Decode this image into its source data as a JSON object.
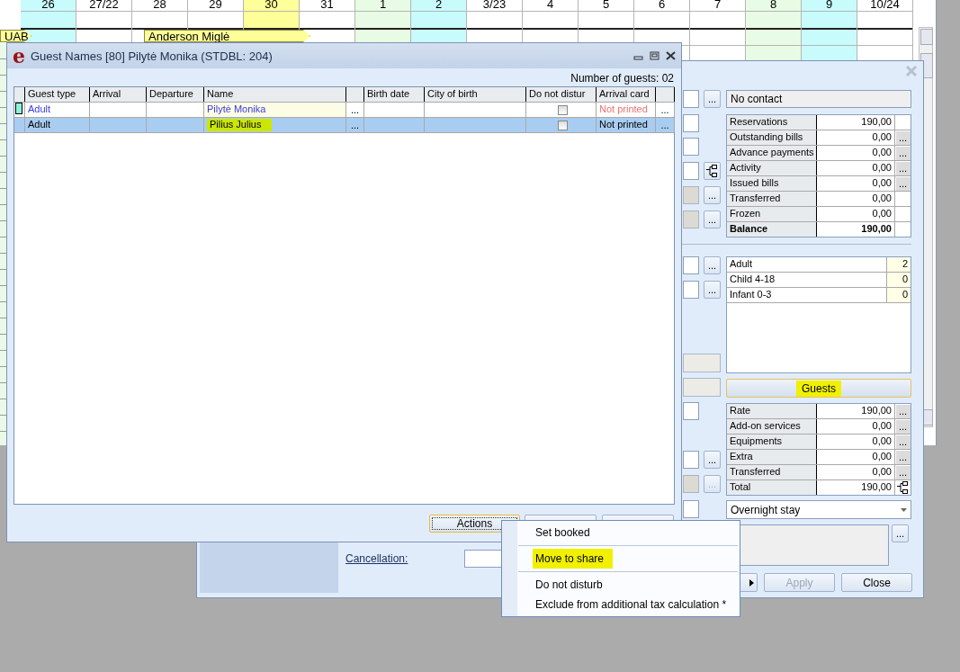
{
  "calendar": {
    "dates": [
      {
        "label": "26",
        "color": "#c8fbfc"
      },
      {
        "label": "27/22",
        "color": "#ffffff"
      },
      {
        "label": "28",
        "color": "#ffffff"
      },
      {
        "label": "29",
        "color": "#ffffff"
      },
      {
        "label": "30",
        "color": "#ffff99"
      },
      {
        "label": "31",
        "color": "#ffffff"
      },
      {
        "label": "1",
        "color": "#e8fbe4"
      },
      {
        "label": "2",
        "color": "#c8fbfc"
      },
      {
        "label": "3/23",
        "color": "#ffffff"
      },
      {
        "label": "4",
        "color": "#ffffff"
      },
      {
        "label": "5",
        "color": "#ffffff"
      },
      {
        "label": "6",
        "color": "#ffffff"
      },
      {
        "label": "7",
        "color": "#ffffff"
      },
      {
        "label": "8",
        "color": "#e8fbe4"
      },
      {
        "label": "9",
        "color": "#c8fbfc"
      },
      {
        "label": "10/24",
        "color": "#ffffff"
      }
    ],
    "bookings": [
      {
        "label": "UAB"
      },
      {
        "label": "Anderson Miglė"
      }
    ]
  },
  "reservation_window": {
    "fields": [
      {
        "kind": "field-button",
        "button_text": "...",
        "readonly": false
      },
      {
        "kind": "field",
        "readonly": false
      },
      {
        "kind": "field",
        "readonly": false
      },
      {
        "kind": "field-tree",
        "readonly": false
      },
      {
        "kind": "field-button",
        "button_text": "...",
        "readonly": true
      },
      {
        "kind": "field-button",
        "button_text": "...",
        "readonly": true
      },
      {
        "kind": "field-button",
        "button_text": "...",
        "readonly": false
      },
      {
        "kind": "field-button",
        "button_text": "...",
        "readonly": false
      },
      {
        "kind": "button"
      },
      {
        "kind": "button"
      },
      {
        "kind": "field",
        "readonly": false
      },
      {
        "kind": "field-button",
        "button_text": "...",
        "readonly": false
      },
      {
        "kind": "field-button",
        "button_text": "...",
        "readonly": true,
        "button_disabled": true
      },
      {
        "kind": "field",
        "readonly": false
      }
    ],
    "contact": "No contact",
    "summary": [
      {
        "label": "Reservations",
        "value": "190,00",
        "kind": "plain",
        "bold": false
      },
      {
        "label": "Outstanding bills",
        "value": "0,00",
        "kind": "dots",
        "button_text": "...",
        "bold": false
      },
      {
        "label": "Advance payments",
        "value": "0,00",
        "kind": "dots",
        "button_text": "...",
        "bold": false
      },
      {
        "label": "Activity",
        "value": "0,00",
        "kind": "dots",
        "button_text": "...",
        "bold": false
      },
      {
        "label": "Issued bills",
        "value": "0,00",
        "kind": "dots",
        "button_text": "...",
        "bold": false
      },
      {
        "label": "Transferred",
        "value": "0,00",
        "kind": "plain",
        "bold": false
      },
      {
        "label": "Frozen",
        "value": "0,00",
        "kind": "plain",
        "bold": false
      },
      {
        "label": "Balance",
        "value": "190,00",
        "kind": "plain",
        "bold": true
      }
    ],
    "counts": [
      {
        "label": "Adult",
        "value": "2"
      },
      {
        "label": "Child 4-18",
        "value": "0"
      },
      {
        "label": "Infant 0-3",
        "value": "0"
      }
    ],
    "guests_button": {
      "label": "Guests",
      "highlighted": true
    },
    "rates": [
      {
        "label": "Rate",
        "value": "190,00",
        "kind": "dots",
        "button_text": "...",
        "bold": false
      },
      {
        "label": "Add-on services",
        "value": "0,00",
        "kind": "dots",
        "button_text": "...",
        "bold": false
      },
      {
        "label": "Equipments",
        "value": "0,00",
        "kind": "dots",
        "button_text": "...",
        "bold": false
      },
      {
        "label": "Extra",
        "value": "0,00",
        "kind": "dots",
        "button_text": "...",
        "bold": false
      },
      {
        "label": "Transferred",
        "value": "0,00",
        "kind": "dots",
        "button_text": "...",
        "bold": false
      },
      {
        "label": "Total",
        "value": "190,00",
        "kind": "tree",
        "bold": false
      }
    ],
    "stay_type": "Overnight stay",
    "notes_button": "...",
    "cancellation_label": "Cancellation:",
    "buttons": [
      {
        "label": "Apply",
        "disabled": true
      },
      {
        "label": "Close",
        "disabled": false
      }
    ]
  },
  "guest_names_window": {
    "logo": "e",
    "title": "Guest Names [80] Pilytė Monika (STDBL: 204)",
    "guest_count": "Number of guests: 02",
    "columns": [
      {
        "label": "Guest type",
        "kind": "text"
      },
      {
        "label": "Arrival",
        "kind": "text"
      },
      {
        "label": "Departure",
        "kind": "text"
      },
      {
        "label": "Name",
        "kind": "text"
      },
      {
        "kind": "button"
      },
      {
        "label": "Birth date",
        "kind": "text"
      },
      {
        "label": "City of birth",
        "kind": "text"
      },
      {
        "label": "Do not distur",
        "kind": "text"
      },
      {
        "label": "Arrival card",
        "kind": "text"
      },
      {
        "kind": "button"
      }
    ],
    "rows": [
      {
        "guest_type": "Adult",
        "name": "Pilytė Monika",
        "name_button": "...",
        "do_not_disturb": false,
        "arrival_card": "Not printed",
        "row_button": "...",
        "primary": true,
        "selected": false,
        "highlighted": false
      },
      {
        "guest_type": "Adult",
        "name": "Pilius Julius",
        "name_button": "...",
        "do_not_disturb": false,
        "arrival_card": "Not printed",
        "row_button": "...",
        "primary": false,
        "selected": true,
        "highlighted": true
      }
    ],
    "actions_button": {
      "label": "Actions",
      "focused": true
    }
  },
  "context_menu": {
    "items": [
      {
        "label": "Set booked",
        "highlighted": false
      },
      {
        "label": "Move to share",
        "highlighted": true
      },
      {
        "label": "Do not disturb",
        "highlighted": false
      },
      {
        "label": "Exclude from additional tax calculation *",
        "highlighted": false
      }
    ]
  }
}
